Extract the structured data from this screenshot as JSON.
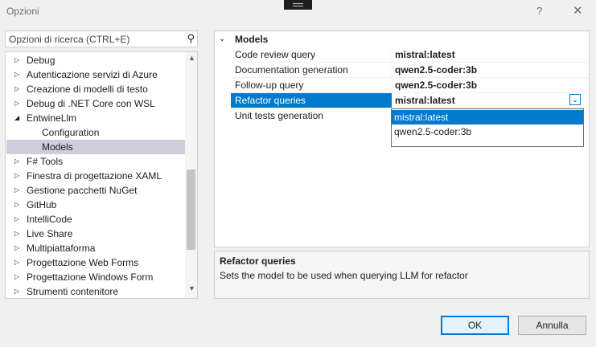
{
  "window": {
    "title": "Opzioni",
    "help_glyph": "?",
    "close_glyph": "✕"
  },
  "search": {
    "placeholder": "Opzioni di ricerca (CTRL+E)",
    "icon": "search-icon"
  },
  "tree": {
    "items": [
      {
        "label": "Debug",
        "expander": "▷"
      },
      {
        "label": "Autenticazione servizi di Azure",
        "expander": "▷"
      },
      {
        "label": "Creazione di modelli di testo",
        "expander": "▷"
      },
      {
        "label": "Debug di .NET Core con WSL",
        "expander": "▷"
      },
      {
        "label": "EntwineLlm",
        "expander": "◢"
      },
      {
        "label": "Configuration",
        "expander": ""
      },
      {
        "label": "Models",
        "expander": "",
        "selected": true
      },
      {
        "label": "F# Tools",
        "expander": "▷"
      },
      {
        "label": "Finestra di progettazione XAML",
        "expander": "▷"
      },
      {
        "label": "Gestione pacchetti NuGet",
        "expander": "▷"
      },
      {
        "label": "GitHub",
        "expander": "▷"
      },
      {
        "label": "IntelliCode",
        "expander": "▷"
      },
      {
        "label": "Live Share",
        "expander": "▷"
      },
      {
        "label": "Multipiattaforma",
        "expander": "▷"
      },
      {
        "label": "Progettazione Web Forms",
        "expander": "▷"
      },
      {
        "label": "Progettazione Windows Form",
        "expander": "▷"
      },
      {
        "label": "Strumenti contenitore",
        "expander": "▷"
      }
    ]
  },
  "grid": {
    "category": "Models",
    "category_toggle": "⌄",
    "properties": [
      {
        "name": "Code review query",
        "value": "mistral:latest"
      },
      {
        "name": "Documentation generation",
        "value": "qwen2.5-coder:3b"
      },
      {
        "name": "Follow-up query",
        "value": "qwen2.5-coder:3b"
      },
      {
        "name": "Refactor queries",
        "value": "mistral:latest",
        "selected": true
      },
      {
        "name": "Unit tests generation",
        "value": ""
      }
    ],
    "dropdown_glyph": "⌄",
    "dropdown_options": [
      {
        "label": "mistral:latest",
        "selected": true
      },
      {
        "label": "qwen2.5-coder:3b",
        "selected": false
      }
    ]
  },
  "description": {
    "title": "Refactor queries",
    "text": "Sets the model to be used when querying LLM for refactor"
  },
  "buttons": {
    "ok": "OK",
    "cancel": "Annulla"
  }
}
